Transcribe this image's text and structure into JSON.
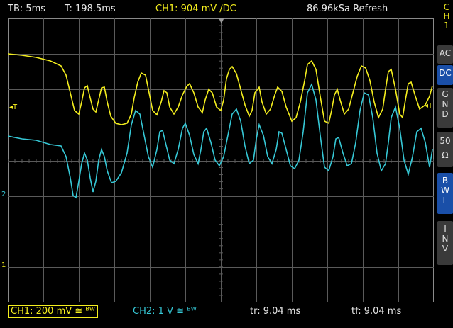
{
  "header": {
    "timebase": "TB: 5ms",
    "trigger_time": "T: 198.5ms",
    "ch1_setting": "CH1: 904 mV ∕DC",
    "sample_rate": "86.96kSa  Refresh"
  },
  "channel_label": [
    "C",
    "H",
    "1"
  ],
  "side_menu": [
    {
      "label": [
        "AC"
      ],
      "active": false
    },
    {
      "label": [
        "DC"
      ],
      "active": true
    },
    {
      "label": [
        "G",
        "N",
        "D"
      ],
      "active": false
    },
    {
      "label": [
        "50",
        "Ω"
      ],
      "active": false
    },
    {
      "label": [
        "B",
        "W",
        "L"
      ],
      "active": true
    },
    {
      "label": [
        "I",
        "N",
        "V"
      ],
      "active": false
    }
  ],
  "markers": {
    "trigger_level": "◂T",
    "ch2_ground": "2",
    "ch1_ground": "1"
  },
  "footer": {
    "ch1_scale": "CH1: 200 mV ≅ ᴮᵂ",
    "ch2_scale": "CH2: 1 V ≅ ᴮᵂ",
    "rise_time": "tr: 9.04 ms",
    "fall_time": "tf: 9.04 ms"
  },
  "colors": {
    "ch1": "#f4ee1e",
    "ch2": "#36c8d6",
    "grid": "#5a5a5a",
    "active_button": "#1a4fa8"
  }
}
